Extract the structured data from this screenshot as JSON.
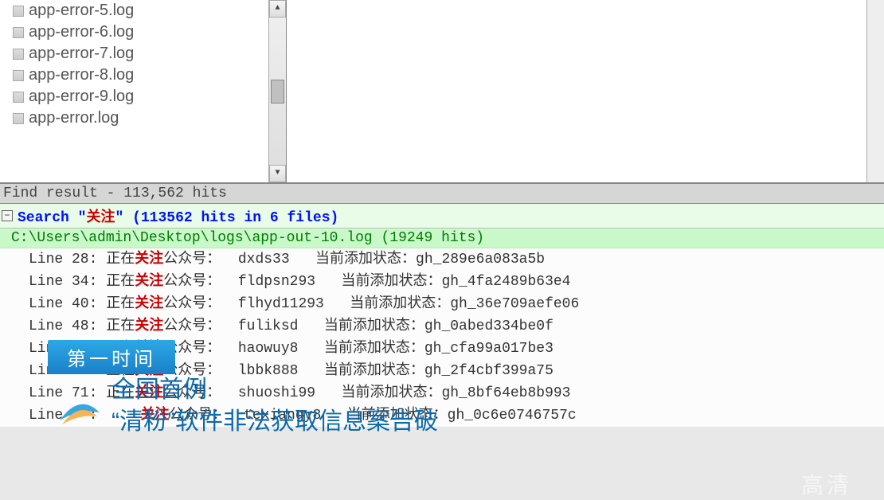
{
  "watermark": "高清",
  "file_list": {
    "items": [
      "app-error-5.log",
      "app-error-6.log",
      "app-error-7.log",
      "app-error-8.log",
      "app-error-9.log",
      "app-error.log"
    ]
  },
  "status_bar": "Find result - 113,562 hits",
  "search": {
    "prefix": "Search ",
    "quote_open": "\"",
    "keyword": "关注",
    "quote_close": "\"",
    "summary": " (113562 hits in 6 files)"
  },
  "file_path_line": "C:\\Users\\admin\\Desktop\\logs\\app-out-10.log (19249 hits)",
  "results": [
    {
      "line_label": "Line 28:",
      "pre": " 正在",
      "kw": "关注",
      "post": "公众号：  dxds33   当前添加状态：gh_289e6a083a5b"
    },
    {
      "line_label": "Line 34:",
      "pre": " 正在",
      "kw": "关注",
      "post": "公众号：  fldpsn293   当前添加状态：gh_4fa2489b63e4"
    },
    {
      "line_label": "Line 40:",
      "pre": " 正在",
      "kw": "关注",
      "post": "公众号：  flhyd11293   当前添加状态：gh_36e709aefe06"
    },
    {
      "line_label": "Line 48:",
      "pre": " 正在",
      "kw": "关注",
      "post": "公众号：  fuliksd   当前添加状态：gh_0abed334be0f"
    },
    {
      "line_label": "Line 56:",
      "pre": " 正在",
      "kw": "关注",
      "post": "公众号：  haowuy8   当前添加状态：gh_cfa99a017be3"
    },
    {
      "line_label": "Line 66:",
      "pre": " 正在",
      "kw": "关注",
      "post": "公众号：  lbbk888   当前添加状态：gh_2f4cbf399a75"
    },
    {
      "line_label": "Line 71:",
      "pre": " 正在",
      "kw": "关注",
      "post": "公众号：  shuoshi99   当前添加状态：gh_8bf64eb8b993"
    },
    {
      "line_label": "Line   :",
      "pre": "     ",
      "kw": "关注",
      "post": "公众号：  texiangy8   当前添加状态：gh_0c6e0746757c"
    }
  ],
  "overlay": {
    "banner": "第一时间",
    "headline_line1": "全国首例",
    "headline_line2": "“清粉”软件非法获取信息案告破"
  }
}
